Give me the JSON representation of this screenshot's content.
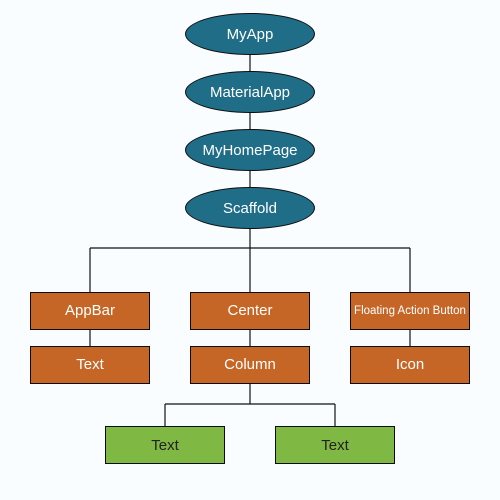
{
  "diagram": {
    "type": "widget-tree",
    "root_chain": [
      {
        "label": "MyApp"
      },
      {
        "label": "MaterialApp"
      },
      {
        "label": "MyHomePage"
      },
      {
        "label": "Scaffold"
      }
    ],
    "branches": {
      "left": {
        "top": "AppBar",
        "bottom": "Text"
      },
      "center": {
        "top": "Center",
        "bottom": "Column"
      },
      "right": {
        "top": "Floating Action Button",
        "bottom": "Icon"
      }
    },
    "leaves": {
      "left": "Text",
      "right": "Text"
    },
    "colors": {
      "ellipse": "#1f6d87",
      "rect": "#c56627",
      "leaf": "#7fb842",
      "outline": "#0d0d0d",
      "background": "#fafdff"
    }
  }
}
